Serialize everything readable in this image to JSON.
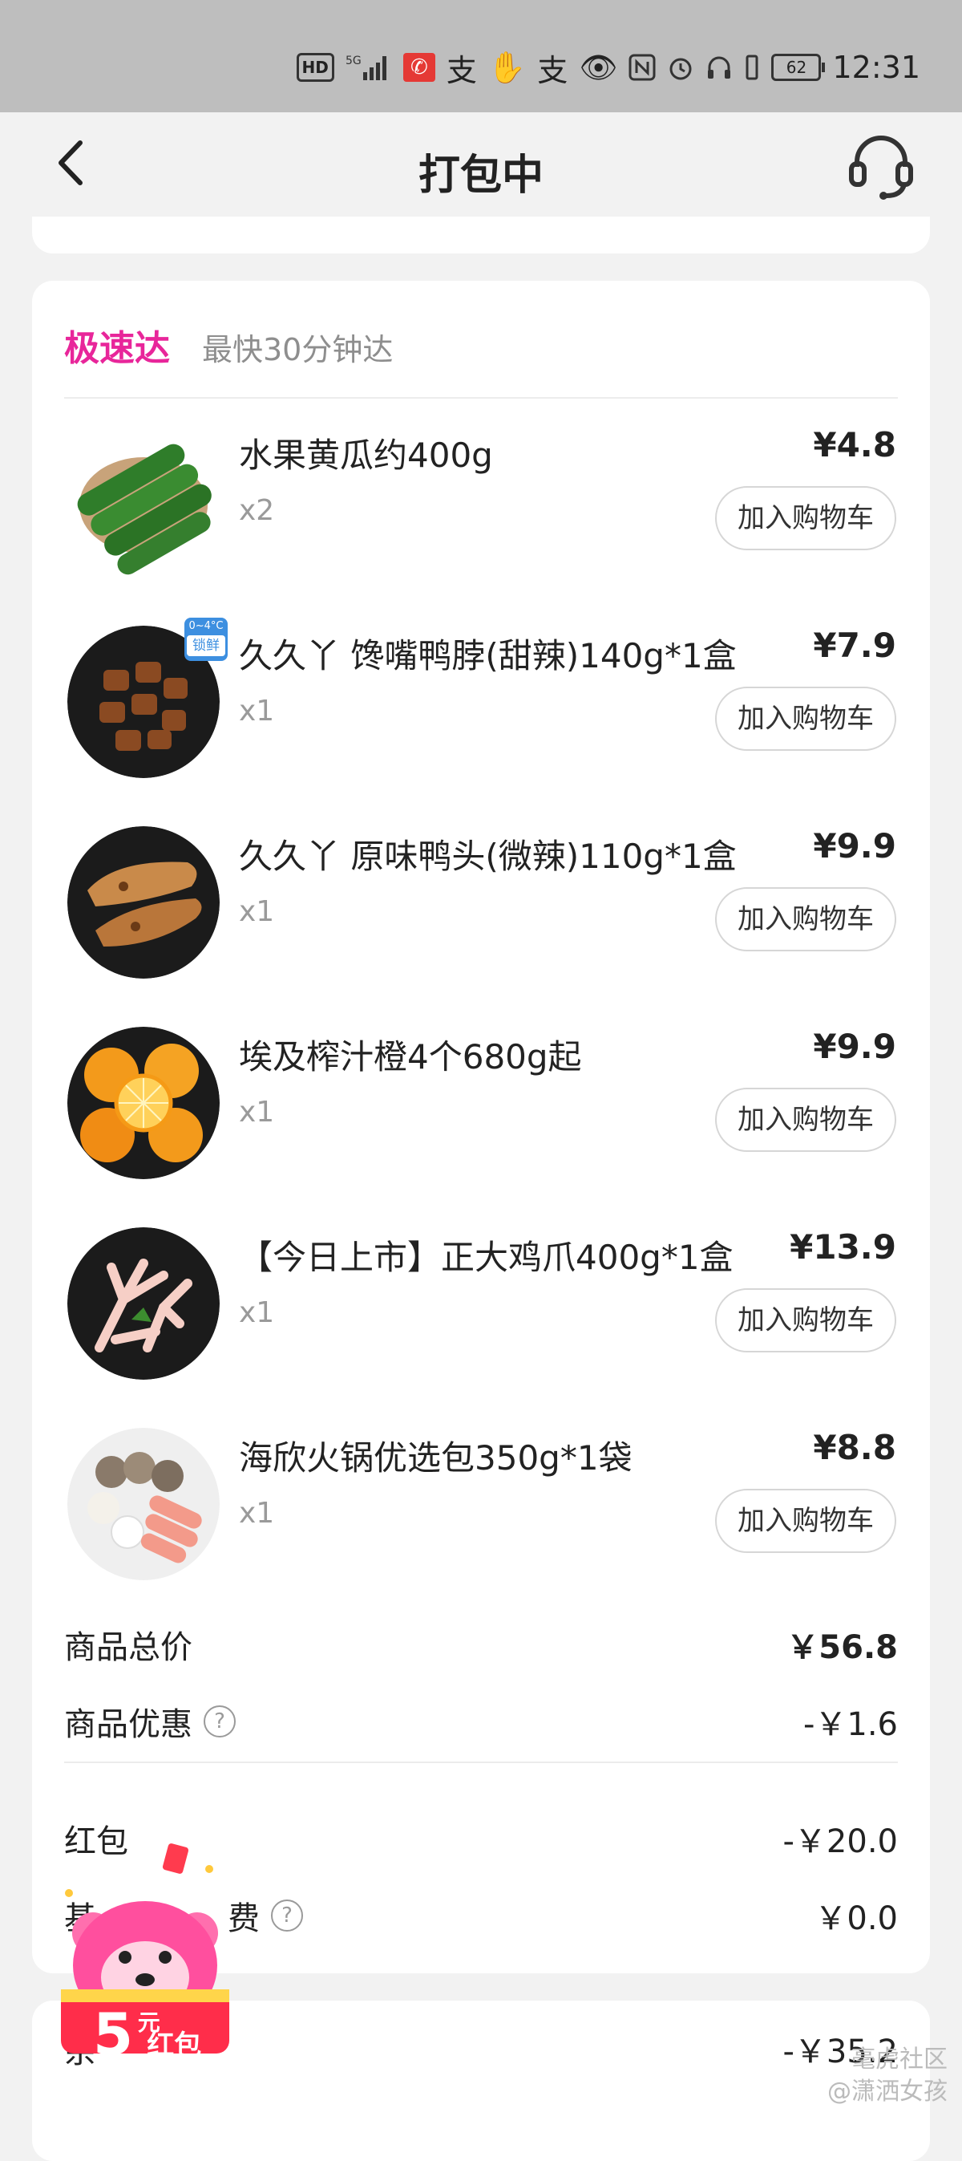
{
  "status_bar": {
    "hd": "HD",
    "network": "5G",
    "battery": "62",
    "time": "12:31"
  },
  "header": {
    "title": "打包中",
    "back_icon": "chevron-left-icon",
    "support_icon": "headset-icon"
  },
  "delivery": {
    "tag": "极速达",
    "subtitle": "最快30分钟达"
  },
  "items": [
    {
      "name": "水果黄瓜约400g",
      "qty": "x2",
      "price": "¥4.8",
      "button": "加入购物车",
      "image": "cucumber"
    },
    {
      "name": "久久丫 馋嘴鸭脖(甜辣)140g*1盒",
      "qty": "x1",
      "price": "¥7.9",
      "button": "加入购物车",
      "image": "duck-neck",
      "badge_top": "0~4°C",
      "badge_bottom": "锁鲜"
    },
    {
      "name": "久久丫 原味鸭头(微辣)110g*1盒",
      "qty": "x1",
      "price": "¥9.9",
      "button": "加入购物车",
      "image": "duck-head"
    },
    {
      "name": "埃及榨汁橙4个680g起",
      "qty": "x1",
      "price": "¥9.9",
      "button": "加入购物车",
      "image": "orange"
    },
    {
      "name": "【今日上市】正大鸡爪400g*1盒",
      "qty": "x1",
      "price": "¥13.9",
      "button": "加入购物车",
      "image": "chicken-feet"
    },
    {
      "name": "海欣火锅优选包350g*1袋",
      "qty": "x1",
      "price": "¥8.8",
      "button": "加入购物车",
      "image": "hotpot"
    }
  ],
  "summary": {
    "total_label": "商品总价",
    "total_value": "￥56.8",
    "discount_label": "商品优惠",
    "discount_value": "-￥1.6",
    "redpacket_label": "红包",
    "redpacket_value": "-￥20.0",
    "fee_label_visible": "基",
    "fee_label_tail": "费",
    "fee_value": "￥0.0"
  },
  "balance": {
    "label": "余",
    "value": "-￥35.2"
  },
  "promo": {
    "amount": "5",
    "unit": "元",
    "text": "红包"
  },
  "watermark": {
    "line1": "毫虎社区",
    "line2": "@潇洒女孩"
  }
}
